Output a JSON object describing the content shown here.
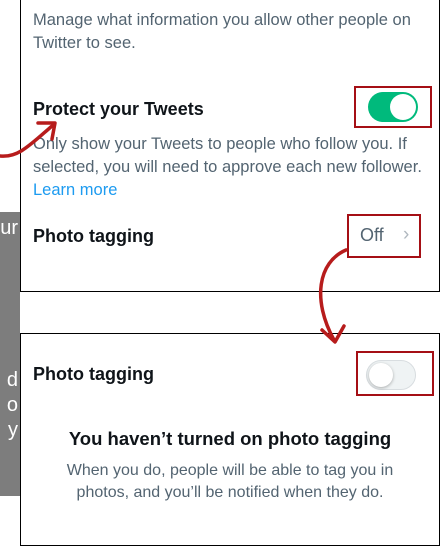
{
  "colors": {
    "toggle_on": "#00ba7c",
    "toggle_off": "#eff3f4",
    "link": "#1d9bf0",
    "highlight_box": "#a50f15",
    "arrow": "#b71c1c",
    "secondary_text": "#536471"
  },
  "top_panel": {
    "intro": "Manage what information you allow other people on Twitter to see.",
    "protect_tweets": {
      "title": "Protect your Tweets",
      "toggle_state": "on",
      "description": "Only show your Tweets to people who follow you. If selected, you will need to approve each new follower.",
      "learn_more": "Learn more"
    },
    "photo_tagging": {
      "label": "Photo tagging",
      "value": "Off",
      "chevron_icon": "chevron-right-icon"
    }
  },
  "bottom_panel": {
    "photo_tagging_label": "Photo tagging",
    "toggle_state": "off",
    "empty_title": "You haven’t turned on photo tagging",
    "empty_description": "When you do, people will be able to tag you in photos, and you’ll be notified when they do."
  },
  "side_panel": {
    "fragments": [
      "ur",
      "d",
      "o",
      "y"
    ]
  }
}
